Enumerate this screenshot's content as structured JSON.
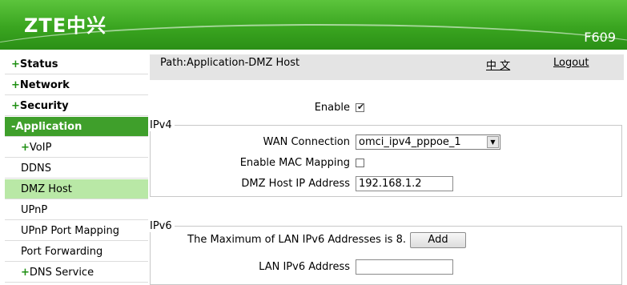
{
  "header": {
    "logo": "ZTE中兴",
    "model": "F609"
  },
  "sidebar": {
    "items": [
      {
        "prefix": "+",
        "label": "Status"
      },
      {
        "prefix": "+",
        "label": "Network"
      },
      {
        "prefix": "+",
        "label": "Security"
      },
      {
        "prefix": "-",
        "label": "Application"
      },
      {
        "prefix": "+",
        "label": "VoIP"
      },
      {
        "prefix": "",
        "label": "DDNS"
      },
      {
        "prefix": "",
        "label": "DMZ Host"
      },
      {
        "prefix": "",
        "label": "UPnP"
      },
      {
        "prefix": "",
        "label": "UPnP Port Mapping"
      },
      {
        "prefix": "",
        "label": "Port Forwarding"
      },
      {
        "prefix": "+",
        "label": "DNS Service"
      }
    ]
  },
  "pathbar": {
    "path": "Path:Application-DMZ Host",
    "lang": "中 文",
    "logout": "Logout"
  },
  "form": {
    "enable_label": "Enable",
    "enable_checked": true,
    "ipv4": {
      "legend": "IPv4",
      "wan_label": "WAN Connection",
      "wan_value": "omci_ipv4_pppoe_1",
      "mac_label": "Enable MAC Mapping",
      "mac_checked": false,
      "dmz_label": "DMZ Host IP Address",
      "dmz_value": "192.168.1.2"
    },
    "ipv6": {
      "legend": "IPv6",
      "max_text": "The Maximum of LAN IPv6 Addresses is 8.",
      "add_label": "Add",
      "lan_label": "LAN IPv6 Address",
      "lan_value": ""
    }
  }
}
